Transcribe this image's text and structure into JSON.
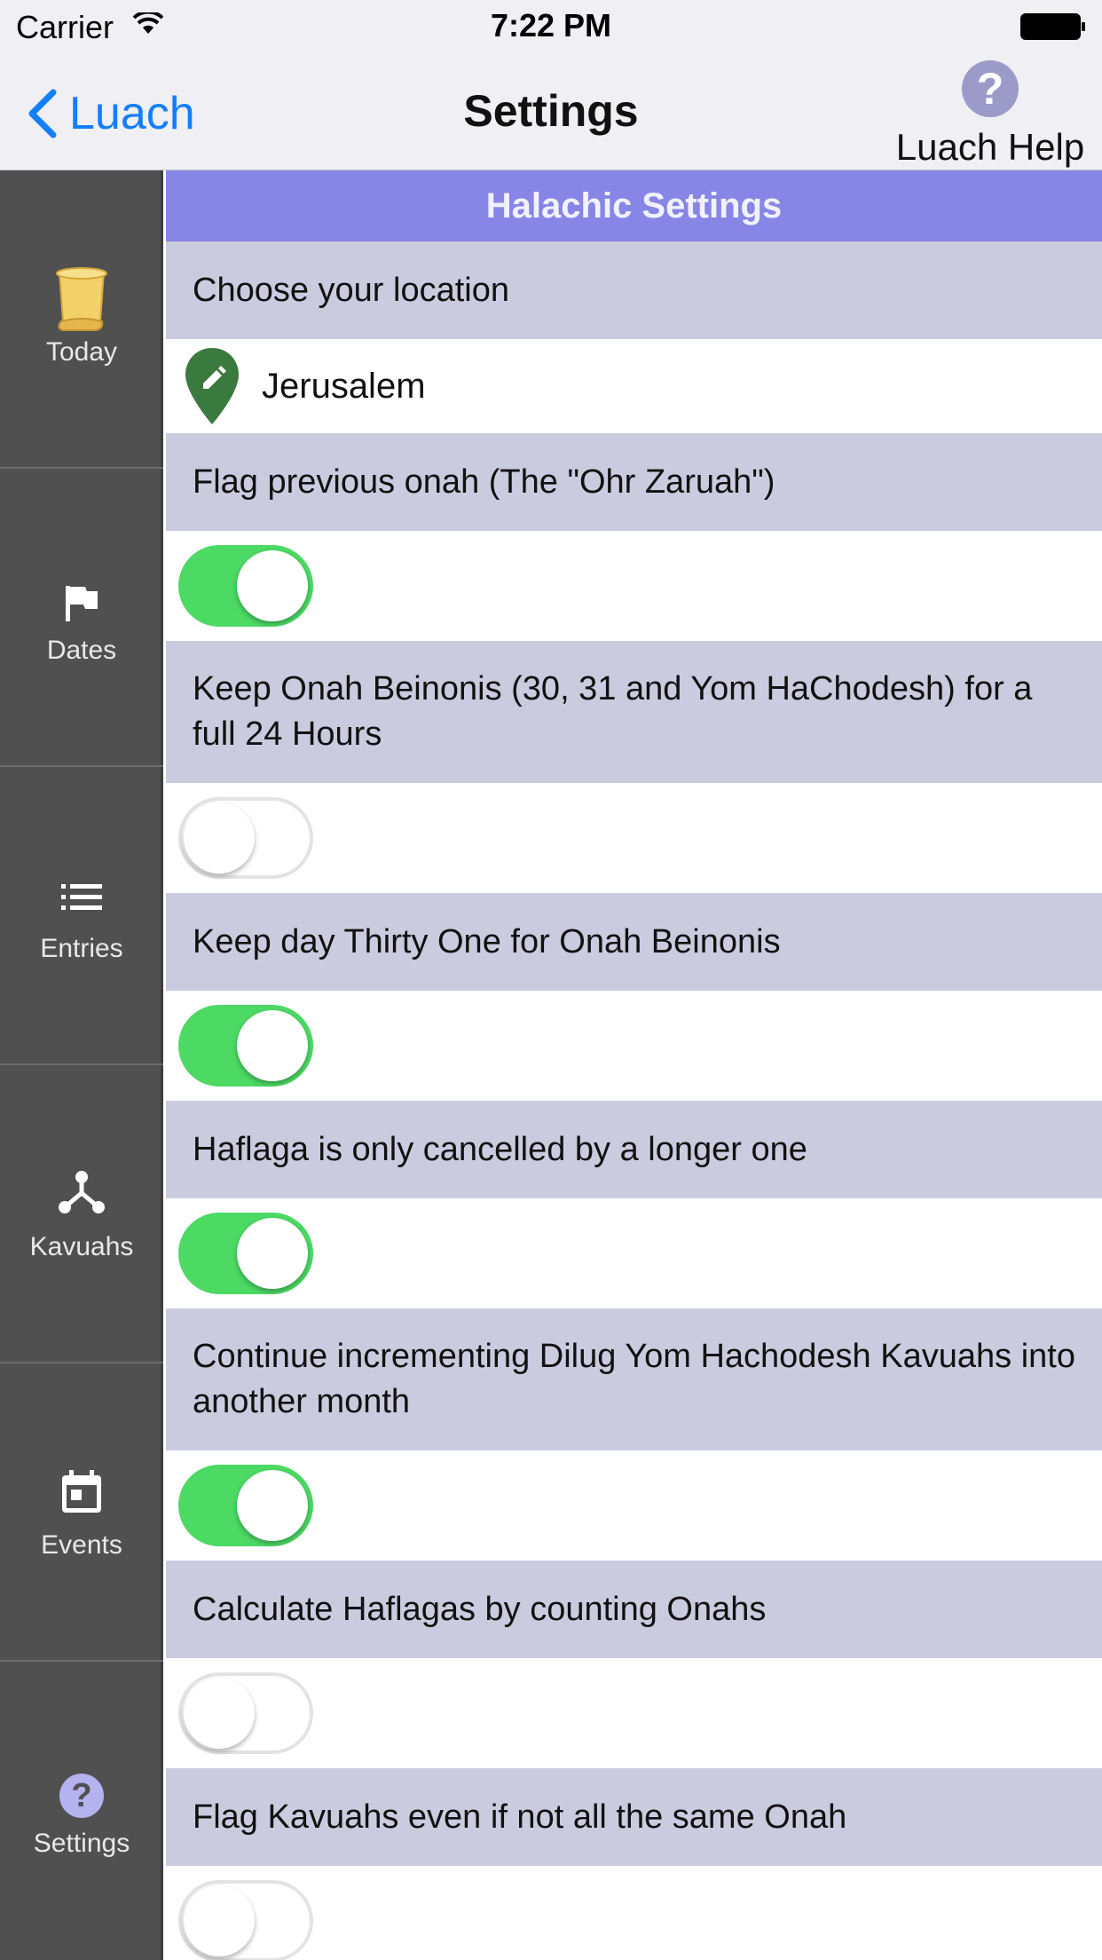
{
  "status_bar": {
    "carrier": "Carrier",
    "time": "7:22 PM"
  },
  "nav": {
    "back_label": "Luach",
    "title": "Settings",
    "help_label": "Luach Help",
    "help_glyph": "?"
  },
  "sidebar": {
    "tabs": [
      {
        "label": "Today",
        "icon": "scroll-icon"
      },
      {
        "label": "Dates",
        "icon": "flag-icon"
      },
      {
        "label": "Entries",
        "icon": "list-icon"
      },
      {
        "label": "Kavuahs",
        "icon": "network-icon"
      },
      {
        "label": "Events",
        "icon": "calendar-icon"
      },
      {
        "label": "Settings",
        "icon": "help-circle-icon",
        "glyph": "?"
      }
    ]
  },
  "settings": {
    "section_title": "Halachic Settings",
    "location": {
      "label": "Choose your location",
      "value": "Jerusalem"
    },
    "items": [
      {
        "label": "Flag previous onah (The \"Ohr Zaruah\")",
        "enabled": true
      },
      {
        "label": "Keep Onah Beinonis (30, 31 and Yom HaChodesh) for a full 24 Hours",
        "enabled": false
      },
      {
        "label": "Keep day Thirty One for Onah Beinonis",
        "enabled": true
      },
      {
        "label": "Haflaga is only cancelled by a longer one",
        "enabled": true
      },
      {
        "label": "Continue incrementing Dilug Yom Hachodesh Kavuahs into another month",
        "enabled": true
      },
      {
        "label": "Calculate Haflagas by counting Onahs",
        "enabled": false
      },
      {
        "label": "Flag Kavuahs even if not all the same Onah",
        "enabled": false
      }
    ]
  },
  "colors": {
    "section_header": "#8786e7",
    "setting_title_bg": "#cbcbe0",
    "sidebar_bg": "#505050",
    "toggle_on": "#4cd964",
    "ios_blue": "#157efb",
    "pin_green": "#3a7a3e",
    "help_purple": "#9c9ac9"
  }
}
